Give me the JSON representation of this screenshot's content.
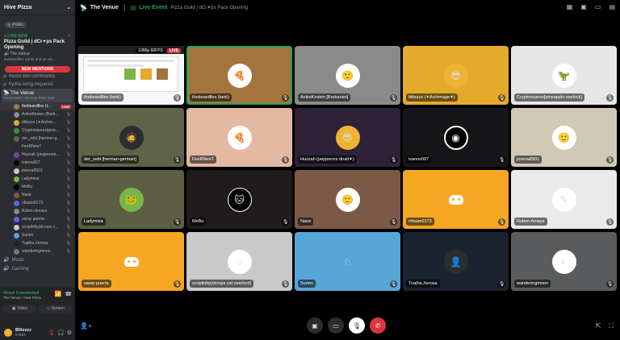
{
  "server": {
    "name": "Hive Pizza",
    "public_label": "Public"
  },
  "live_card": {
    "live_now": "LIVE NOW",
    "title": "Pizza Guild | dCr✦ps Pack Opening",
    "venue": "The Venue",
    "hosts": "thebeardflex (tank) and 18 oth..."
  },
  "new_mentions": "NEW MENTIONS",
  "channels": [
    "music-bot-commands",
    "hydra-song-requests"
  ],
  "venue_channel": {
    "name": "The Venue",
    "sub": "Pizza Guild | dCr✦ps Pack Ope..."
  },
  "voice_users": [
    {
      "name": "thebeardflex (t...",
      "live": "LIVE",
      "self": true
    },
    {
      "name": "AnikeKirsten [Barb..."
    },
    {
      "name": "blitzzzz (✦Archm..."
    },
    {
      "name": "Cryptoniusrex(pine..."
    },
    {
      "name": "der_sebi [herman-g..."
    },
    {
      "name": "FeeRNeeT"
    },
    {
      "name": "Huzzah (pepperoni..."
    },
    {
      "name": "ivanov007"
    },
    {
      "name": "joseva8901"
    },
    {
      "name": "Ladymisa"
    },
    {
      "name": "MeBu"
    },
    {
      "name": "Nane"
    },
    {
      "name": "nftsam0173"
    },
    {
      "name": "Ruben Amaya"
    },
    {
      "name": "saray puerta"
    },
    {
      "name": "scriptkitty(dcrops c..."
    },
    {
      "name": "Surien"
    },
    {
      "name": "Tuaiha.Xerosa"
    },
    {
      "name": "wanderingmoon"
    }
  ],
  "categories": [
    "Music",
    "Gaming"
  ],
  "voice_panel": {
    "status": "Voice Connected",
    "sub": "The Venue / Hive Pizza",
    "video_label": "Video",
    "screen_label": "Screen"
  },
  "user_panel": {
    "name": "Blitzzzz",
    "tag": "#7267"
  },
  "topbar": {
    "venue": "The Venue",
    "live_event": "Live Event",
    "event_title": "Pizza Guild | dCr✦ps Pack Opening"
  },
  "stream": {
    "fps": "1080p 60FPS",
    "live": "LIVE"
  },
  "tiles": [
    {
      "label": "thebeardflex (tank)",
      "bg": "#f7f7f7",
      "avatar": "stream"
    },
    {
      "label": "thebeardflex (tank)",
      "bg": "#a3753d",
      "avatar": "pizza",
      "speaking": true
    },
    {
      "label": "AnikeKirsten [Barbarian]",
      "bg": "#8a8a8a",
      "avatar": "person"
    },
    {
      "label": "blitzzzz (✦Archmage✦)",
      "bg": "#e4aa2c",
      "avatar": "character"
    },
    {
      "label": "Cryptoniusrex[pineapple warlock]",
      "bg": "#e6e6e6",
      "avatar": "dino"
    },
    {
      "label": "der_sebi [herman-german]",
      "bg": "#5f6449",
      "avatar": "dark"
    },
    {
      "label": "FeeRNeeT",
      "bg": "#e4b9a4",
      "avatar": "pizza"
    },
    {
      "label": "Huzzah (pepperoni druid✦)",
      "bg": "#2d2238",
      "avatar": "character"
    },
    {
      "label": "ivanov007",
      "bg": "#161618",
      "avatar": "swirl"
    },
    {
      "label": "joseva8901",
      "bg": "#d2c8b6",
      "avatar": "person"
    },
    {
      "label": "Ladymisa",
      "bg": "#5d5f45",
      "avatar": "frog"
    },
    {
      "label": "MeBu",
      "bg": "#201b1c",
      "avatar": "cat"
    },
    {
      "label": "Nane",
      "bg": "#7a5a47",
      "avatar": "person"
    },
    {
      "label": "nftsam0173",
      "bg": "#f5a623",
      "avatar": "discord"
    },
    {
      "label": "Ruben Amaya",
      "bg": "#eaeaea",
      "avatar": "sketch"
    },
    {
      "label": "saray puerta",
      "bg": "#f5a623",
      "avatar": "discord"
    },
    {
      "label": "scriptkitty(dcrops cat overlord)",
      "bg": "#c9c9c9",
      "avatar": "house"
    },
    {
      "label": "Surien",
      "bg": "#58a5d8",
      "avatar": "sigil"
    },
    {
      "label": "Tuaiha.Xerosa",
      "bg": "#1c2330",
      "avatar": "shadow"
    },
    {
      "label": "wanderingmoon",
      "bg": "#5a5b5d",
      "avatar": "moon"
    }
  ]
}
